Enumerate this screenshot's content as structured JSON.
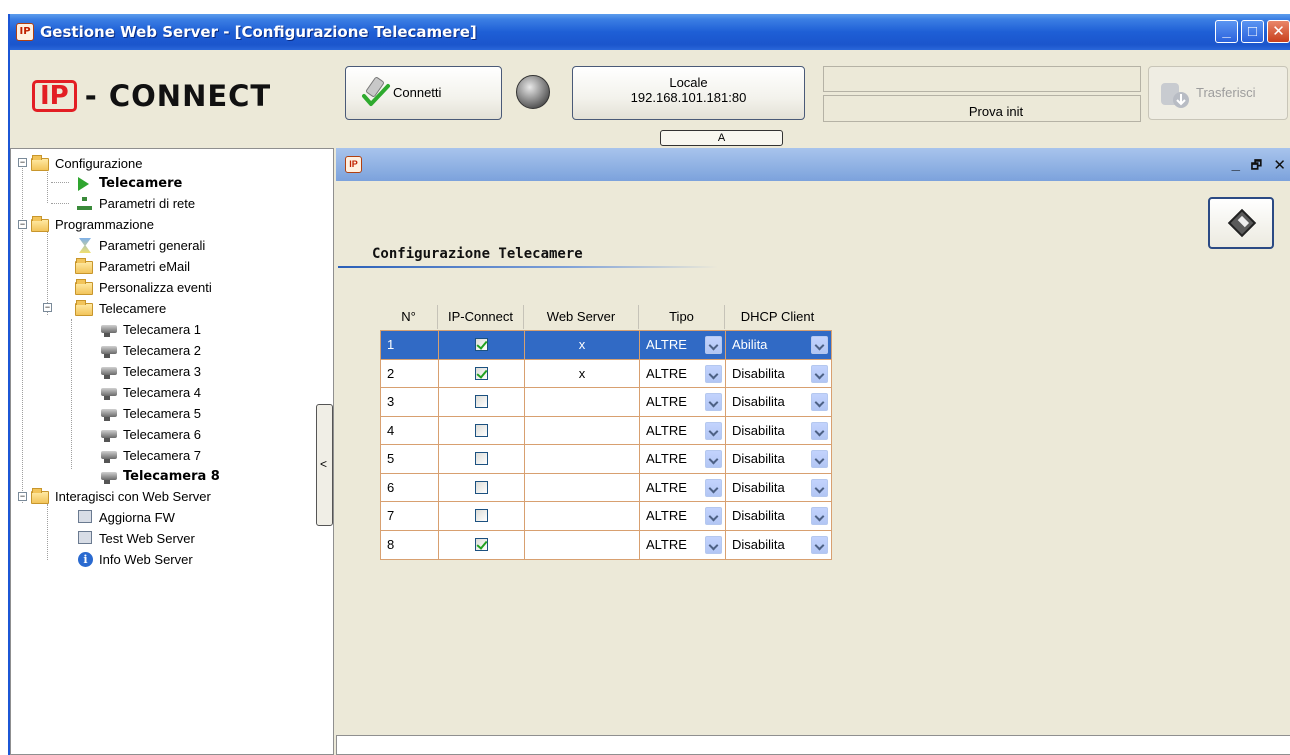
{
  "window": {
    "title": "Gestione Web Server - [Configurazione Telecamere]",
    "app_icon_text": "IP"
  },
  "logo": {
    "ip": "IP",
    "brand": "- CONNECT"
  },
  "toolbar": {
    "connetti_label": "Connetti",
    "locale_line1": "Locale",
    "locale_line2": "192.168.101.181:80",
    "a_button_label": "A",
    "status_top": "",
    "status_bottom": "Prova init",
    "trasferisci_label": "Trasferisci"
  },
  "tree": {
    "items": [
      {
        "label": "Configurazione"
      },
      {
        "label": "Telecamere"
      },
      {
        "label": "Parametri di rete"
      },
      {
        "label": "Programmazione"
      },
      {
        "label": "Parametri generali"
      },
      {
        "label": "Parametri eMail"
      },
      {
        "label": "Personalizza eventi"
      },
      {
        "label": "Telecamere"
      },
      {
        "label": "Telecamera 1"
      },
      {
        "label": "Telecamera 2"
      },
      {
        "label": "Telecamera 3"
      },
      {
        "label": "Telecamera 4"
      },
      {
        "label": "Telecamera 5"
      },
      {
        "label": "Telecamera 6"
      },
      {
        "label": "Telecamera 7"
      },
      {
        "label": "Telecamera 8"
      },
      {
        "label": "Interagisci con Web Server"
      },
      {
        "label": "Aggiorna FW"
      },
      {
        "label": "Test Web Server"
      },
      {
        "label": "Info Web Server"
      }
    ],
    "collapse_label": "<"
  },
  "child": {
    "section_title": "Configurazione Telecamere",
    "grid": {
      "headers": [
        "N°",
        "IP-Connect",
        "Web Server",
        "Tipo",
        "DHCP Client"
      ],
      "rows": [
        {
          "n": "1",
          "ip": true,
          "ws": "x",
          "tipo": "ALTRE",
          "dhcp": "Abilita"
        },
        {
          "n": "2",
          "ip": true,
          "ws": "x",
          "tipo": "ALTRE",
          "dhcp": "Disabilita"
        },
        {
          "n": "3",
          "ip": false,
          "ws": "",
          "tipo": "ALTRE",
          "dhcp": "Disabilita"
        },
        {
          "n": "4",
          "ip": false,
          "ws": "",
          "tipo": "ALTRE",
          "dhcp": "Disabilita"
        },
        {
          "n": "5",
          "ip": false,
          "ws": "",
          "tipo": "ALTRE",
          "dhcp": "Disabilita"
        },
        {
          "n": "6",
          "ip": false,
          "ws": "",
          "tipo": "ALTRE",
          "dhcp": "Disabilita"
        },
        {
          "n": "7",
          "ip": false,
          "ws": "",
          "tipo": "ALTRE",
          "dhcp": "Disabilita"
        },
        {
          "n": "8",
          "ip": true,
          "ws": "",
          "tipo": "ALTRE",
          "dhcp": "Disabilita"
        }
      ]
    }
  },
  "colors": {
    "title_bar": "#1e5fd6",
    "selection": "#316ac5",
    "grid_border": "#d8a070",
    "logo_red": "#e31e24",
    "face": "#ece9d8"
  }
}
